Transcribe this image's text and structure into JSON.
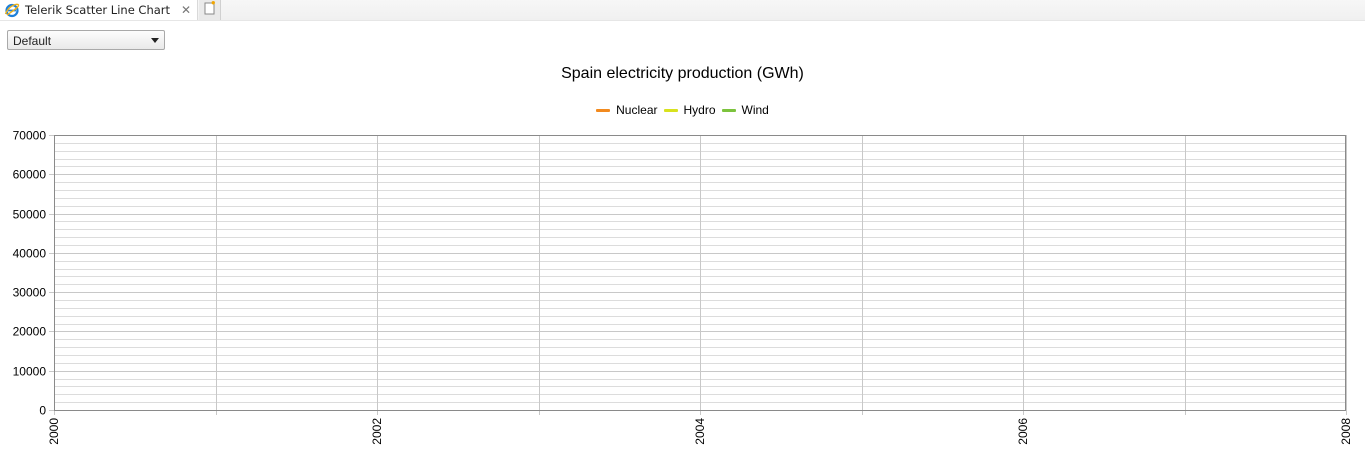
{
  "tab": {
    "title": "Telerik Scatter Line Chart",
    "close_glyph": "✕",
    "icon": "ie-browser-icon",
    "new_tab_icon": "new-tab-icon"
  },
  "selector": {
    "value": "Default"
  },
  "colors": {
    "nuclear": "#f28a1e",
    "hydro": "#d8e21e",
    "wind": "#7cc33d",
    "grid": "#c8c8c8",
    "axis": "#8a8a8a"
  },
  "chart_data": {
    "type": "line",
    "title": "Spain electricity production (GWh)",
    "xlabel": "",
    "ylabel": "",
    "xlim": [
      2000,
      2008
    ],
    "ylim": [
      0,
      70000
    ],
    "x_ticks": [
      "2000",
      "2002",
      "2004",
      "2006",
      "2008"
    ],
    "y_ticks": [
      "0",
      "10000",
      "20000",
      "30000",
      "40000",
      "50000",
      "60000",
      "70000"
    ],
    "x_tick_label_rotation": "vertical",
    "grid": true,
    "legend_position": "top-center",
    "series": [
      {
        "name": "Nuclear",
        "values": []
      },
      {
        "name": "Hydro",
        "values": []
      },
      {
        "name": "Wind",
        "values": []
      }
    ]
  }
}
